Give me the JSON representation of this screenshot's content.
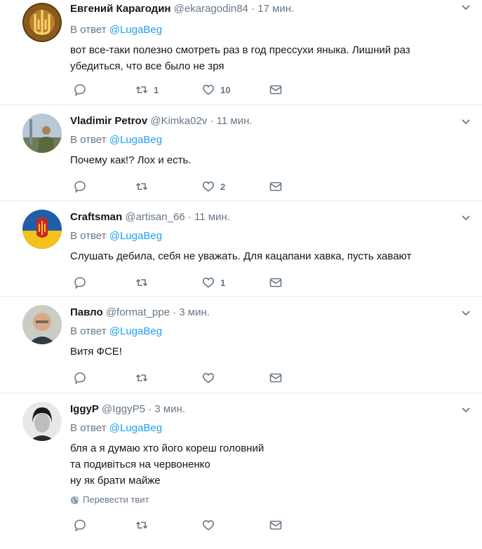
{
  "reply_prefix": "В ответ",
  "translate_label": "Перевести твит",
  "colors": {
    "link": "#1da1f2",
    "muted": "#657786",
    "text": "#14171a",
    "divider": "#e6ecf0"
  },
  "tweets": [
    {
      "fullname": "Евгений Карагодин",
      "username": "@ekaragodin84",
      "time": "17 мин.",
      "reply_to": "@LugaBeg",
      "lines": [
        "вот все-таки полезно смотреть раз в год прессухи яныка. Лишний раз",
        "убедиться, что все было не зря"
      ],
      "retweets": "1",
      "likes": "10",
      "avatar": "trident-icon"
    },
    {
      "fullname": "Vladimir Petrov",
      "username": "@Kimka02v",
      "time": "11 мин.",
      "reply_to": "@LugaBeg",
      "lines": [
        "Почему как!? Лох и есть."
      ],
      "retweets": "",
      "likes": "2",
      "avatar": "photo-man-outdoors"
    },
    {
      "fullname": "Craftsman",
      "username": "@artisan_66",
      "time": "11 мин.",
      "reply_to": "@LugaBeg",
      "lines": [
        "Слушать дебила, себя не уважать. Для кацапани хавка, пусть хавают"
      ],
      "retweets": "",
      "likes": "1",
      "avatar": "flag-emblem"
    },
    {
      "fullname": "Павло",
      "username": "@format_ppe",
      "time": "3 мин.",
      "reply_to": "@LugaBeg",
      "lines": [
        "Витя ФСЕ!"
      ],
      "retweets": "",
      "likes": "",
      "avatar": "photo-man-face"
    },
    {
      "fullname": "IggyP",
      "username": "@IggyP5",
      "time": "3 мин.",
      "reply_to": "@LugaBeg",
      "lines": [
        "бля а я думаю хто його кореш головний",
        "та подивіться на червоненко",
        "ну як брати майже"
      ],
      "retweets": "",
      "likes": "",
      "avatar": "photo-bw-portrait"
    }
  ]
}
